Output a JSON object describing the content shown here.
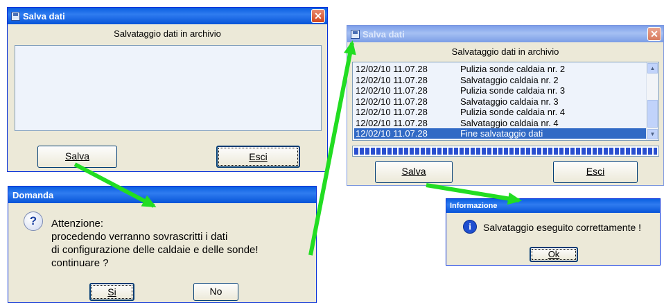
{
  "window1": {
    "title": "Salva dati",
    "heading": "Salvataggio dati in archivio",
    "save_label": "Salva",
    "exit_label": "Esci"
  },
  "dialog_question": {
    "title": "Domanda",
    "line1": "Attenzione:",
    "line2": "procedendo verranno sovrascritti i dati",
    "line3": "di configurazione delle caldaie e delle sonde!",
    "line4": "continuare ?",
    "yes_label": "Si",
    "no_label": "No",
    "icon": "question-icon"
  },
  "window2": {
    "title": "Salva dati",
    "heading": "Salvataggio dati in archivio",
    "log": [
      {
        "time": "12/02/10 11.07.28",
        "message": "Pulizia sonde caldaia nr. 2"
      },
      {
        "time": "12/02/10 11.07.28",
        "message": "Salvataggio caldaia nr. 2"
      },
      {
        "time": "12/02/10 11.07.28",
        "message": "Pulizia sonde caldaia nr. 3"
      },
      {
        "time": "12/02/10 11.07.28",
        "message": "Salvataggio caldaia nr. 3"
      },
      {
        "time": "12/02/10 11.07.28",
        "message": "Pulizia sonde caldaia nr. 4"
      },
      {
        "time": "12/02/10 11.07.28",
        "message": "Salvataggio caldaia nr. 4"
      },
      {
        "time": "12/02/10 11.07.28",
        "message": "Fine salvataggio dati"
      }
    ],
    "progress_fraction": 1.0,
    "save_label": "Salva",
    "exit_label": "Esci"
  },
  "dialog_info": {
    "title": "Informazione",
    "message": "Salvataggio eseguito correttamente !",
    "ok_label": "Ok",
    "icon": "info-icon"
  },
  "colors": {
    "arrow": "#22dd22",
    "selection": "#316ac5",
    "titlebar_active": "#0a5fe0",
    "titlebar_inactive": "#7c9ee8"
  }
}
